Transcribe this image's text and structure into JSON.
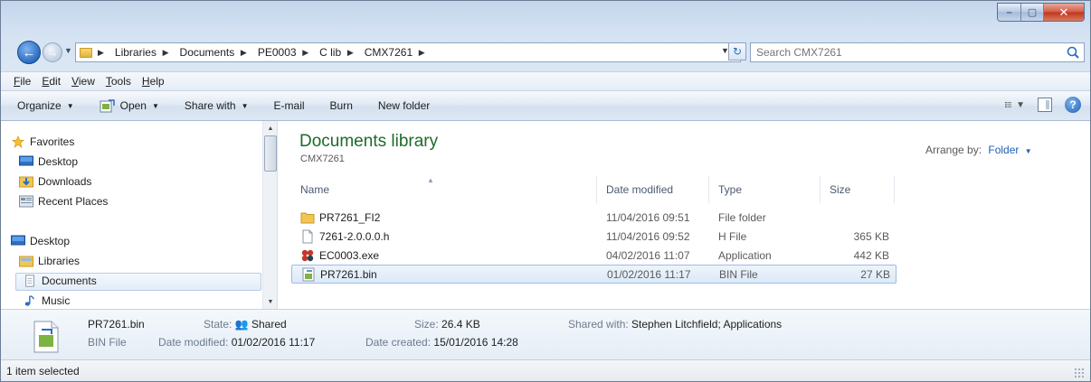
{
  "window": {
    "caption": {
      "minimize": "–",
      "maximize": "▢",
      "close": "✕"
    }
  },
  "address": {
    "crumbs": [
      "Libraries",
      "Documents",
      "PE0003",
      "C lib",
      "CMX7261"
    ]
  },
  "search": {
    "placeholder": "Search CMX7261"
  },
  "menu": {
    "items": [
      {
        "label": "File",
        "accel": "F"
      },
      {
        "label": "Edit",
        "accel": "E"
      },
      {
        "label": "View",
        "accel": "V"
      },
      {
        "label": "Tools",
        "accel": "T"
      },
      {
        "label": "Help",
        "accel": "H"
      }
    ]
  },
  "commands": {
    "organize": "Organize",
    "open": "Open",
    "share_with": "Share with",
    "email": "E-mail",
    "burn": "Burn",
    "new_folder": "New folder",
    "help": "?"
  },
  "nav": {
    "items": [
      {
        "label": "Favorites",
        "icon": "star-icon"
      },
      {
        "label": "Desktop",
        "icon": "desktop-icon"
      },
      {
        "label": "Downloads",
        "icon": "downloads-icon"
      },
      {
        "label": "Recent Places",
        "icon": "recent-places-icon"
      },
      {
        "label": "Desktop",
        "icon": "desktop-icon"
      },
      {
        "label": "Libraries",
        "icon": "libraries-icon"
      },
      {
        "label": "Documents",
        "icon": "documents-icon"
      },
      {
        "label": "Music",
        "icon": "music-icon"
      }
    ]
  },
  "library": {
    "title": "Documents library",
    "subtitle": "CMX7261",
    "arrange_label": "Arrange by:",
    "arrange_value": "Folder"
  },
  "columns": {
    "name": "Name",
    "date": "Date modified",
    "type": "Type",
    "size": "Size"
  },
  "files": [
    {
      "name": "PR7261_FI2",
      "date": "11/04/2016 09:51",
      "type": "File folder",
      "size": "",
      "icon": "folder-icon"
    },
    {
      "name": "7261-2.0.0.0.h",
      "date": "11/04/2016 09:52",
      "type": "H File",
      "size": "365 KB",
      "icon": "document-icon"
    },
    {
      "name": "EC0003.exe",
      "date": "04/02/2016 11:07",
      "type": "Application",
      "size": "442 KB",
      "icon": "application-icon"
    },
    {
      "name": "PR7261.bin",
      "date": "01/02/2016 11:17",
      "type": "BIN File",
      "size": "27 KB",
      "icon": "bin-file-icon"
    }
  ],
  "details": {
    "filename": "PR7261.bin",
    "filetype": "BIN File",
    "state_label": "State:",
    "state_value": "Shared",
    "modified_label": "Date modified:",
    "modified_value": "01/02/2016 11:17",
    "size_label": "Size:",
    "size_value": "26.4 KB",
    "created_label": "Date created:",
    "created_value": "15/01/2016 14:28",
    "shared_label": "Shared with:",
    "shared_value": "Stephen Litchfield; Applications"
  },
  "status": {
    "text": "1 item selected"
  }
}
